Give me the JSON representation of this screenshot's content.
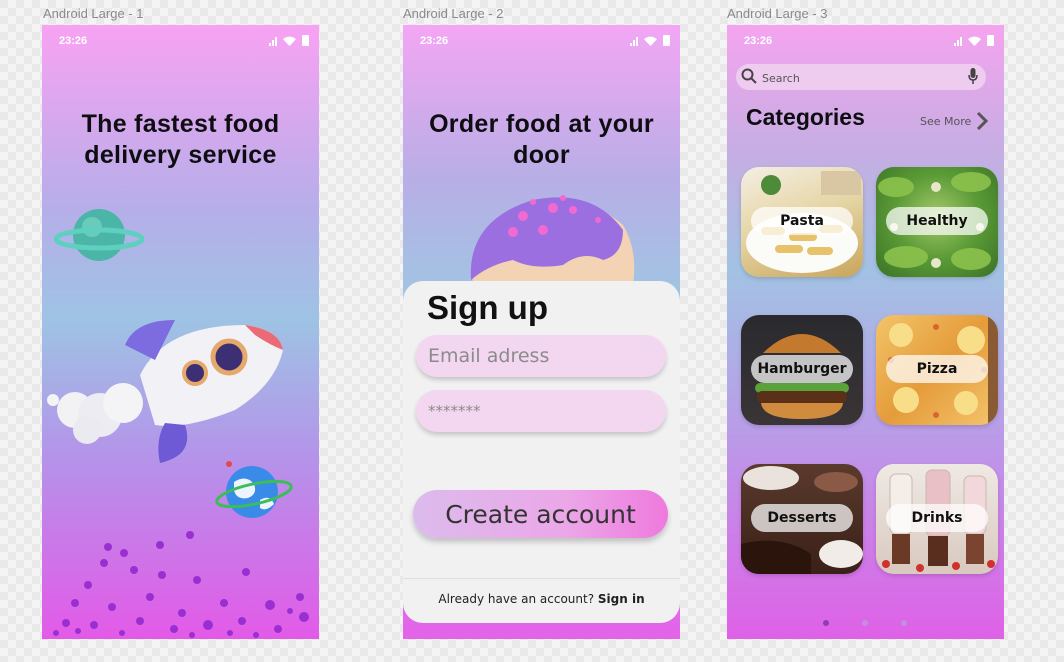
{
  "frames": {
    "frame1": {
      "label": "Android Large - 1"
    },
    "frame2": {
      "label": "Android Large - 2"
    },
    "frame3": {
      "label": "Android Large - 3"
    }
  },
  "status_bar": {
    "time": "23:26"
  },
  "screen1": {
    "headline": "The fastest food delivery service"
  },
  "screen2": {
    "headline": "Order food at your door",
    "signup_title": "Sign up",
    "email_placeholder": "Email adress",
    "password_value": "*******",
    "create_button": "Create account",
    "already_text": "Already have an account? ",
    "signin_link": "Sign in"
  },
  "screen3": {
    "search_placeholder": "Search",
    "categories_title": "Categories",
    "see_more": "See More",
    "categories": [
      {
        "label": "Pasta"
      },
      {
        "label": "Healthy"
      },
      {
        "label": "Hamburger"
      },
      {
        "label": "Pizza"
      },
      {
        "label": "Desserts"
      },
      {
        "label": "Drinks"
      }
    ],
    "page_count": 3,
    "active_page": 1
  },
  "colors": {
    "accent_pink": "#e35ae8",
    "text_dark": "#0d0d12"
  }
}
